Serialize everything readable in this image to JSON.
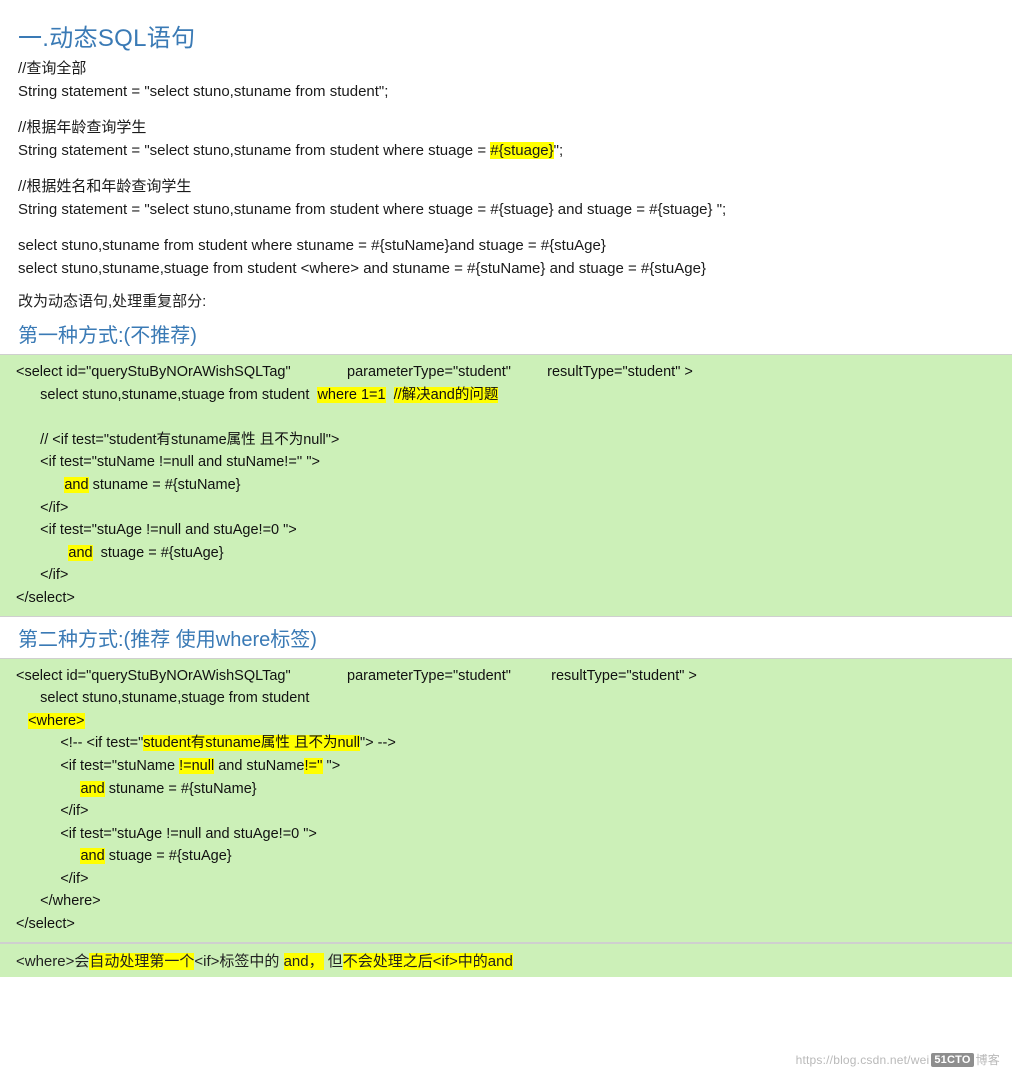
{
  "document": {
    "title": "一.动态SQL语句",
    "intro": {
      "c1": "//查询全部",
      "l1": "String statement = \"select stuno,stuname from student\";",
      "c2": "//根据年龄查询学生",
      "l2a": "String statement = \"select stuno,stuname from student where stuage = ",
      "l2hl": "#{stuage}",
      "l2b": "\";",
      "c3": "//根据姓名和年龄查询学生",
      "l3": "String statement = \"select stuno,stuname from student where stuage = #{stuage} and stuage = #{stuage} \";",
      "l4": "select stuno,stuname from student where  stuname = #{stuName}and  stuage = #{stuAge}",
      "l5": "select stuno,stuname,stuage from student <where> and stuname = #{stuName}  and  stuage = #{stuAge}"
    },
    "transition": "改为动态语句,处理重复部分:",
    "section1": {
      "heading": "第一种方式:(不推荐)",
      "lines": [
        {
          "parts": [
            {
              "t": "<select id=\"queryStuByNOrAWishSQLTag\"              parameterType=\"student\"         resultType=\"student\" >"
            }
          ]
        },
        {
          "parts": [
            {
              "t": "      select stuno,stuname,stuage from student  "
            },
            {
              "t": "where 1=1",
              "hl": true
            },
            {
              "t": "  "
            },
            {
              "t": "//解决and的问题",
              "hl": true
            }
          ]
        },
        {
          "parts": [
            {
              "t": ""
            }
          ]
        },
        {
          "parts": [
            {
              "t": "      // <if test=\"student有stuname属性 且不为null\">"
            }
          ]
        },
        {
          "parts": [
            {
              "t": "      <if test=\"stuName !=null and stuName!='' \">"
            }
          ]
        },
        {
          "parts": [
            {
              "t": "            "
            },
            {
              "t": "and",
              "hl": true
            },
            {
              "t": " stuname = #{stuName}"
            }
          ]
        },
        {
          "parts": [
            {
              "t": "      </if>"
            }
          ]
        },
        {
          "parts": [
            {
              "t": "      <if test=\"stuAge !=null and stuAge!=0 \">"
            }
          ]
        },
        {
          "parts": [
            {
              "t": "             "
            },
            {
              "t": "and",
              "hl": true
            },
            {
              "t": "  stuage = #{stuAge}"
            }
          ]
        },
        {
          "parts": [
            {
              "t": "      </if>"
            }
          ]
        },
        {
          "parts": [
            {
              "t": "</select>"
            }
          ]
        }
      ]
    },
    "section2": {
      "heading": "第二种方式:(推荐 使用where标签)",
      "lines": [
        {
          "parts": [
            {
              "t": "<select id=\"queryStuByNOrAWishSQLTag\"              parameterType=\"student\"          resultType=\"student\" >"
            }
          ]
        },
        {
          "parts": [
            {
              "t": "      select stuno,stuname,stuage from student"
            }
          ]
        },
        {
          "parts": [
            {
              "t": "   "
            },
            {
              "t": "<where>",
              "hl": true
            }
          ]
        },
        {
          "parts": [
            {
              "t": "           <!-- <if test=\""
            },
            {
              "t": "student有stuname属性 且不为null",
              "hl": true
            },
            {
              "t": "\"> -->"
            }
          ]
        },
        {
          "parts": [
            {
              "t": "           <if test=\"stuName "
            },
            {
              "t": "!=null",
              "hl": true
            },
            {
              "t": " and stuName"
            },
            {
              "t": "!=''",
              "hl": true
            },
            {
              "t": " \">"
            }
          ]
        },
        {
          "parts": [
            {
              "t": "                "
            },
            {
              "t": "and",
              "hl": true
            },
            {
              "t": " stuname = #{stuName}"
            }
          ]
        },
        {
          "parts": [
            {
              "t": "           </if>"
            }
          ]
        },
        {
          "parts": [
            {
              "t": "           <if test=\"stuAge !=null and stuAge!=0 \">"
            }
          ]
        },
        {
          "parts": [
            {
              "t": "                "
            },
            {
              "t": "and",
              "hl": true
            },
            {
              "t": " stuage = #{stuAge}"
            }
          ]
        },
        {
          "parts": [
            {
              "t": "           </if>"
            }
          ]
        },
        {
          "parts": [
            {
              "t": "      </where>"
            }
          ]
        },
        {
          "parts": [
            {
              "t": "</select>"
            }
          ]
        }
      ]
    },
    "footer": {
      "parts": [
        {
          "t": "<where>会"
        },
        {
          "t": "自动处理第一个",
          "hl": true
        },
        {
          "t": "<if>标签中的 "
        },
        {
          "t": "and，",
          "hl": true
        },
        {
          "t": " 但"
        },
        {
          "t": "不会处理之后<if>中的and",
          "hl": true
        }
      ]
    },
    "watermark": {
      "url": "https://blog.csdn.net/wei",
      "logo": "51CTO",
      "suffix": "博客"
    }
  }
}
